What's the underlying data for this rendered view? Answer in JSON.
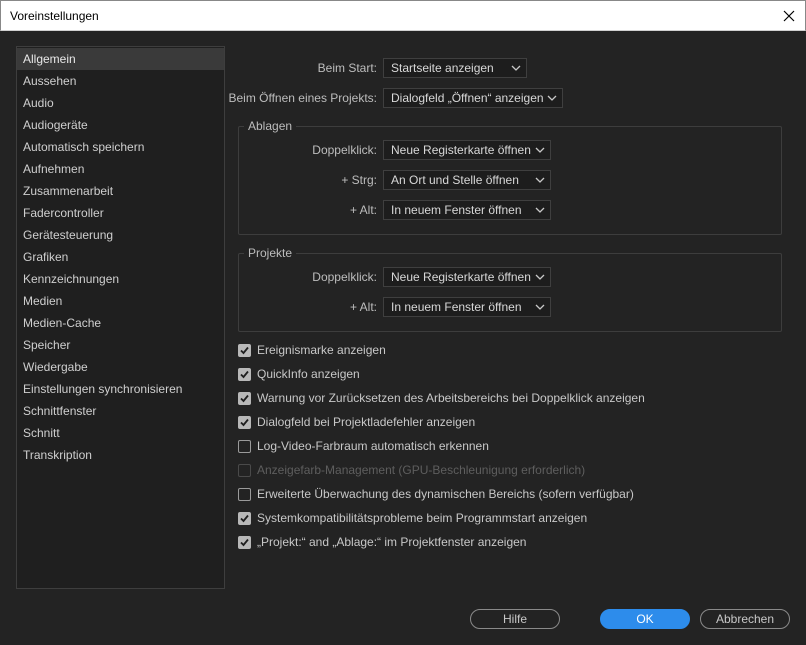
{
  "window": {
    "title": "Voreinstellungen"
  },
  "sidebar": {
    "items": [
      {
        "label": "Allgemein",
        "active": true
      },
      {
        "label": "Aussehen"
      },
      {
        "label": "Audio"
      },
      {
        "label": "Audiogeräte"
      },
      {
        "label": "Automatisch speichern"
      },
      {
        "label": "Aufnehmen"
      },
      {
        "label": "Zusammenarbeit"
      },
      {
        "label": "Fadercontroller"
      },
      {
        "label": "Gerätesteuerung"
      },
      {
        "label": "Grafiken"
      },
      {
        "label": "Kennzeichnungen"
      },
      {
        "label": "Medien"
      },
      {
        "label": "Medien-Cache"
      },
      {
        "label": "Speicher"
      },
      {
        "label": "Wiedergabe"
      },
      {
        "label": "Einstellungen synchronisieren"
      },
      {
        "label": "Schnittfenster"
      },
      {
        "label": "Schnitt"
      },
      {
        "label": "Transkription"
      }
    ]
  },
  "general": {
    "startup_label": "Beim Start:",
    "startup_value": "Startseite anzeigen",
    "open_project_label": "Beim Öffnen eines Projekts:",
    "open_project_value": "Dialogfeld „Öffnen“ anzeigen"
  },
  "bins": {
    "title": "Ablagen",
    "double_click_label": "Doppelklick:",
    "double_click_value": "Neue Registerkarte öffnen",
    "ctrl_label": "+ Strg:",
    "ctrl_value": "An Ort und Stelle öffnen",
    "alt_label": "+ Alt:",
    "alt_value": "In neuem Fenster öffnen"
  },
  "projects": {
    "title": "Projekte",
    "double_click_label": "Doppelklick:",
    "double_click_value": "Neue Registerkarte öffnen",
    "alt_label": "+ Alt:",
    "alt_value": "In neuem Fenster öffnen"
  },
  "checkboxes": [
    {
      "label": "Ereignismarke anzeigen",
      "checked": true,
      "enabled": true
    },
    {
      "label": "QuickInfo anzeigen",
      "checked": true,
      "enabled": true
    },
    {
      "label": "Warnung vor Zurücksetzen des Arbeitsbereichs bei Doppelklick anzeigen",
      "checked": true,
      "enabled": true
    },
    {
      "label": "Dialogfeld bei Projektladefehler anzeigen",
      "checked": true,
      "enabled": true
    },
    {
      "label": "Log-Video-Farbraum automatisch erkennen",
      "checked": false,
      "enabled": true
    },
    {
      "label": "Anzeigefarb-Management (GPU-Beschleunigung erforderlich)",
      "checked": false,
      "enabled": false
    },
    {
      "label": "Erweiterte Überwachung des dynamischen Bereichs (sofern verfügbar)",
      "checked": false,
      "enabled": true
    },
    {
      "label": "Systemkompatibilitätsprobleme beim Programmstart anzeigen",
      "checked": true,
      "enabled": true
    },
    {
      "label": "„Projekt:“ and „Ablage:“ im Projektfenster anzeigen",
      "checked": true,
      "enabled": true
    }
  ],
  "buttons": {
    "help": "Hilfe",
    "ok": "OK",
    "cancel": "Abbrechen"
  },
  "colors": {
    "accent": "#2d8ceb",
    "background": "#232323"
  }
}
